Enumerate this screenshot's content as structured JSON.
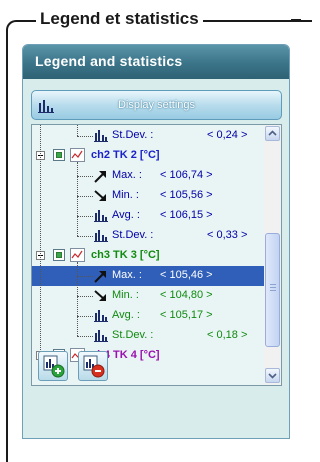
{
  "frame": {
    "title": "Legend et statistics"
  },
  "panel": {
    "title": "Legend and statistics"
  },
  "display_settings": {
    "label": "Display settings"
  },
  "tree": {
    "rows": [
      {
        "kind": "stat",
        "stat": "stdev",
        "label": "St.Dev. :",
        "value": "< 0,24 >",
        "color": "blue"
      },
      {
        "kind": "group",
        "id": "ch2",
        "label": "ch2  TK 2 [°C]",
        "color": "blue",
        "expanded": true
      },
      {
        "kind": "stat",
        "stat": "max",
        "label": "Max. :",
        "value": "< 106,74 >",
        "color": "blue"
      },
      {
        "kind": "stat",
        "stat": "min",
        "label": "Min. :",
        "value": "< 105,56 >",
        "color": "blue"
      },
      {
        "kind": "stat",
        "stat": "avg",
        "label": "Avg. :",
        "value": "< 106,15 >",
        "color": "blue"
      },
      {
        "kind": "stat",
        "stat": "stdev",
        "label": "St.Dev. :",
        "value": "< 0,33 >",
        "color": "blue"
      },
      {
        "kind": "group",
        "id": "ch3",
        "label": "ch3  TK 3 [°C]",
        "color": "green",
        "expanded": true
      },
      {
        "kind": "stat",
        "stat": "max",
        "label": "Max. :",
        "value": "< 105,46 >",
        "color": "green",
        "selected": true
      },
      {
        "kind": "stat",
        "stat": "min",
        "label": "Min. :",
        "value": "< 104,80 >",
        "color": "green"
      },
      {
        "kind": "stat",
        "stat": "avg",
        "label": "Avg. :",
        "value": "< 105,17 >",
        "color": "green"
      },
      {
        "kind": "stat",
        "stat": "stdev",
        "label": "St.Dev. :",
        "value": "< 0,18 >",
        "color": "green"
      },
      {
        "kind": "group",
        "id": "ch4",
        "label": "ch4  TK 4 [°C]",
        "color": "purple",
        "expanded": false
      }
    ]
  },
  "colors": {
    "blue": "#0000a8",
    "green": "#108a10",
    "purple": "#9a10b0",
    "selection": "#2f5fb8",
    "header": "#3b7488",
    "panel_bg": "#d8ecec"
  },
  "icons": {
    "display_settings": "bar-chart-icon",
    "max": "arrow-up-icon",
    "min": "arrow-down-icon",
    "avg": "bar-chart-icon",
    "stdev": "bar-chart-icon",
    "add_button": "add-series-icon",
    "remove_button": "remove-series-icon"
  }
}
